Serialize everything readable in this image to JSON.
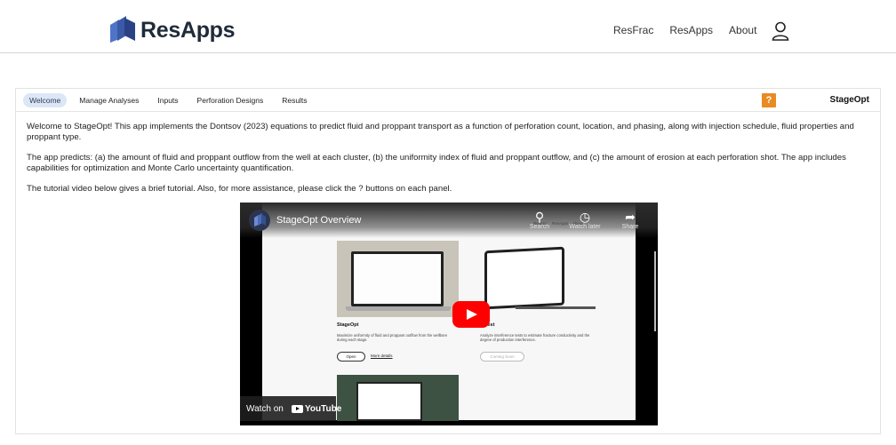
{
  "header": {
    "logo_text": "ResApps",
    "nav": [
      "ResFrac",
      "ResApps",
      "About"
    ]
  },
  "app": {
    "tabs": [
      "Welcome",
      "Manage Analyses",
      "Inputs",
      "Perforation Designs",
      "Results"
    ],
    "active_tab": "Welcome",
    "help_label": "?",
    "name": "StageOpt",
    "paragraphs": [
      "Welcome to StageOpt! This app implements the Dontsov (2023) equations to predict fluid and proppant transport as a function of perforation count, location, and phasing, along with injection schedule, fluid properties and proppant type.",
      "The app predicts: (a) the amount of fluid and proppant outflow from the well at each cluster, (b) the uniformity index of fluid and proppant outflow, and (c) the amount of erosion at each perforation shot. The app includes capabilities for optimization and Monte Carlo uncertainty quantification.",
      "The tutorial video below gives a brief tutorial. Also, for more assistance, please click the ? buttons on each panel."
    ]
  },
  "video": {
    "title": "StageOpt Overview",
    "controls": [
      {
        "icon": "search-icon",
        "label": "Search"
      },
      {
        "icon": "clock-icon",
        "label": "Watch later"
      },
      {
        "icon": "share-icon",
        "label": "Share"
      }
    ],
    "mini_nav": [
      "ResFrac",
      "ResApps",
      "About"
    ],
    "card1": {
      "title": "StageOpt",
      "text": "Maximize uniformity of fluid and proppant outflow from the wellbore during each stage.",
      "open": "Open",
      "more": "More details"
    },
    "card2": {
      "title": "…Test",
      "text": "Analyze interference tests to estimate fracture conductivity and the degree of production interference.",
      "button": "Coming Soon"
    },
    "watch_on": "Watch on",
    "youtube": "YouTube",
    "colors": {
      "play": "#ff0000",
      "help": "#e98a23",
      "active_tab": "#dce6f5"
    }
  }
}
